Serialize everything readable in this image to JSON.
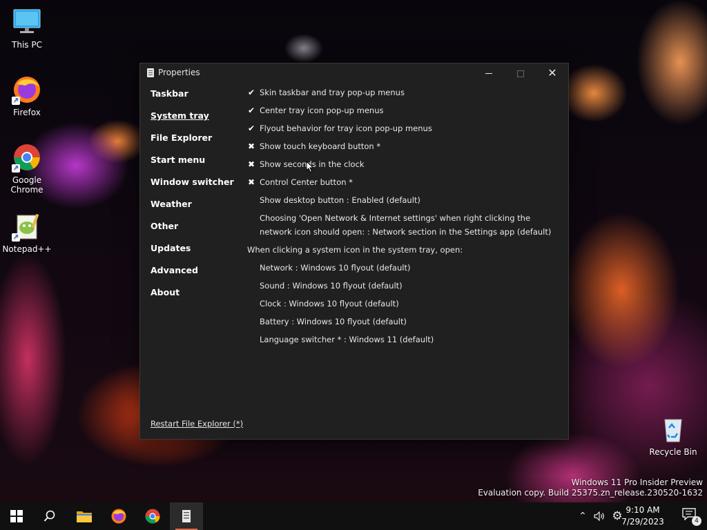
{
  "desktop": {
    "icons": [
      {
        "label": "This PC",
        "icon": "monitor-icon"
      },
      {
        "label": "Firefox",
        "icon": "firefox-icon"
      },
      {
        "label": "Google Chrome",
        "icon": "chrome-icon"
      },
      {
        "label": "Notepad++",
        "icon": "notepad-plus-plus-icon"
      },
      {
        "label": "Recycle Bin",
        "icon": "recycle-bin-icon"
      }
    ],
    "watermark": {
      "line1": "Windows 11 Pro Insider Preview",
      "line2": "Evaluation copy. Build 25375.zn_release.230520-1632"
    }
  },
  "window": {
    "title": "Properties",
    "sidebar": [
      {
        "label": "Taskbar",
        "active": false
      },
      {
        "label": "System tray",
        "active": true
      },
      {
        "label": "File Explorer",
        "active": false
      },
      {
        "label": "Start menu",
        "active": false
      },
      {
        "label": "Window switcher",
        "active": false
      },
      {
        "label": "Weather",
        "active": false
      },
      {
        "label": "Other",
        "active": false
      },
      {
        "label": "Updates",
        "active": false
      },
      {
        "label": "Advanced",
        "active": false
      },
      {
        "label": "About",
        "active": false
      }
    ],
    "settings": [
      {
        "mark": "✔",
        "text": "Skin taskbar and tray pop-up menus"
      },
      {
        "mark": "✔",
        "text": "Center tray icon pop-up menus"
      },
      {
        "mark": "✔",
        "text": "Flyout behavior for tray icon pop-up menus"
      },
      {
        "mark": "✖",
        "text": "Show touch keyboard button *"
      },
      {
        "mark": "✖",
        "text": "Show seconds in the clock"
      },
      {
        "mark": "✖",
        "text": "Control Center button *"
      },
      {
        "mark": "",
        "text": "Show desktop button : Enabled (default)"
      },
      {
        "mark": "",
        "text": "Choosing 'Open Network & Internet settings' when right clicking the network icon should open: : Network section in the Settings app (default)"
      }
    ],
    "system_icons_header": "When clicking a system icon in the system tray, open:",
    "system_icons": [
      "Network : Windows 10 flyout (default)",
      "Sound : Windows 10 flyout (default)",
      "Clock : Windows 10 flyout (default)",
      "Battery : Windows 10 flyout (default)",
      "Language switcher * : Windows 11 (default)"
    ],
    "restart_link": "Restart File Explorer (*)"
  },
  "taskbar": {
    "buttons": [
      {
        "icon": "windows-start-icon"
      },
      {
        "icon": "search-icon"
      },
      {
        "icon": "file-explorer-icon"
      },
      {
        "icon": "firefox-icon"
      },
      {
        "icon": "chrome-icon"
      },
      {
        "icon": "properties-app-icon",
        "active": true
      }
    ],
    "tray": {
      "chevron_icon": "chevron-up-icon",
      "volume_icon": "volume-icon",
      "settings_icon": "gear-icon",
      "time": "9:10 AM",
      "date": "7/29/2023",
      "notification_count": "4"
    }
  },
  "colors": {
    "window_bg": "#202020",
    "taskbar_bg": "#101010",
    "active_indicator": "#e06a4a"
  }
}
